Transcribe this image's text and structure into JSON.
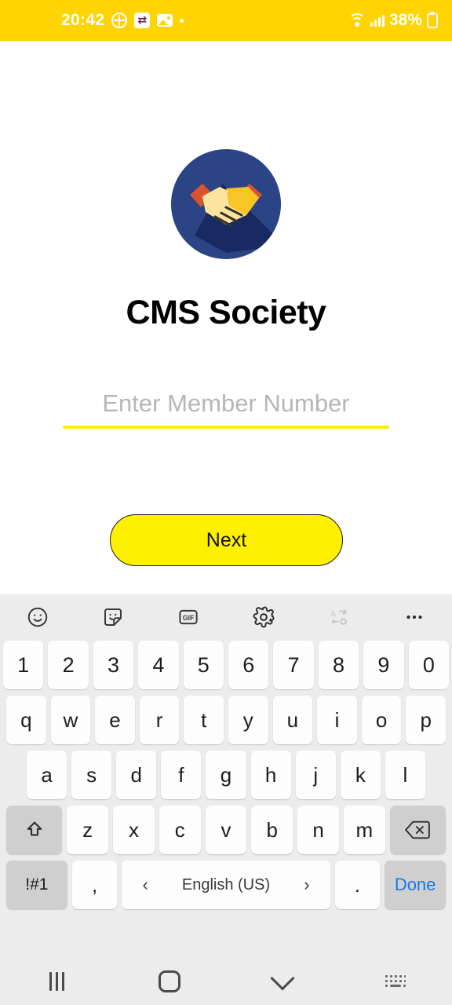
{
  "statusbar": {
    "time": "20:42",
    "battery_text": "38%",
    "icons": [
      "target-icon",
      "app-notification-icon",
      "photo-icon",
      "dot-icon",
      "wifi-icon",
      "signal-icon",
      "battery-charging-icon"
    ],
    "background_color": "#FFD400",
    "text_color": "#FFFFFF"
  },
  "app": {
    "logo_name": "handshake-logo",
    "logo_bg_color": "#2B4485",
    "title": "CMS Society",
    "member_input": {
      "value": "",
      "placeholder": "Enter Member Number",
      "underline_color": "#FFF000"
    },
    "next_button": {
      "label": "Next",
      "background_color": "#FFF000",
      "text_color": "#111111"
    }
  },
  "keyboard": {
    "background_color": "#ECECEC",
    "toolbar": [
      {
        "name": "emoji-icon",
        "label": ""
      },
      {
        "name": "sticker-icon",
        "label": ""
      },
      {
        "name": "gif-icon",
        "label": "GIF"
      },
      {
        "name": "settings-gear-icon",
        "label": ""
      },
      {
        "name": "translate-icon",
        "label": ""
      },
      {
        "name": "more-options-icon",
        "label": ""
      }
    ],
    "rows": {
      "numbers": [
        "1",
        "2",
        "3",
        "4",
        "5",
        "6",
        "7",
        "8",
        "9",
        "0"
      ],
      "top": [
        "q",
        "w",
        "e",
        "r",
        "t",
        "y",
        "u",
        "i",
        "o",
        "p"
      ],
      "home": [
        "a",
        "s",
        "d",
        "f",
        "g",
        "h",
        "j",
        "k",
        "l"
      ],
      "bottom": [
        "z",
        "x",
        "c",
        "v",
        "b",
        "n",
        "m"
      ]
    },
    "shift_key": "shift-icon",
    "backspace_key": "backspace-icon",
    "symbols_key": "!#1",
    "comma_key": ",",
    "period_key": ".",
    "space_label": "English (US)",
    "space_prev": "‹",
    "space_next": "›",
    "done_key": "Done",
    "done_color": "#1877F2"
  },
  "navbar": {
    "recents": "recents-icon",
    "home": "home-icon",
    "hide_keyboard": "chevron-down-icon",
    "keyboard_switch": "keyboard-switch-icon",
    "background_color": "#ECECEC"
  }
}
